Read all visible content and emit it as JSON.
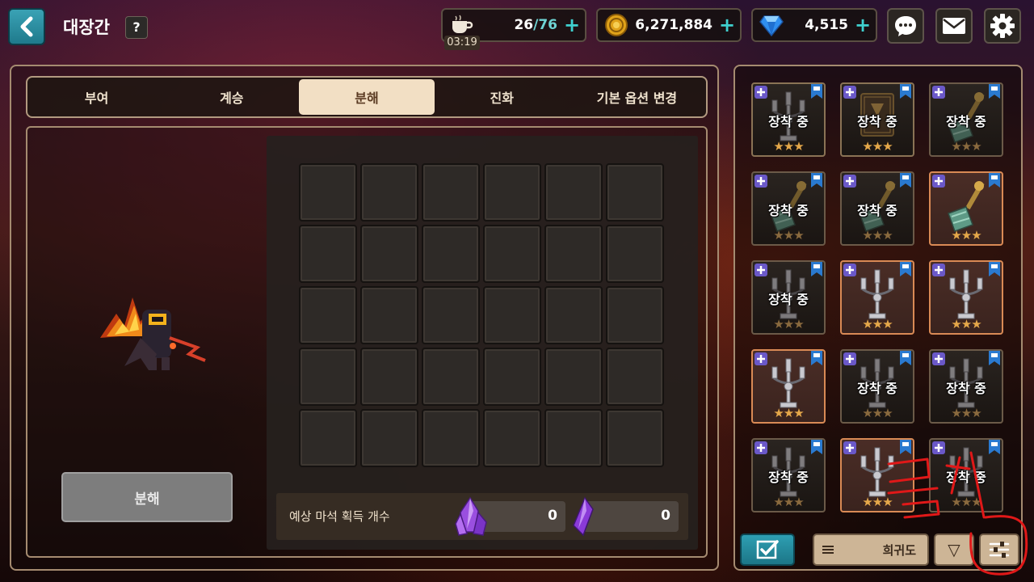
{
  "header": {
    "title": "대장간",
    "help_label": "?",
    "stamina": {
      "current": "26",
      "separator": "/",
      "max": "76",
      "timer": "03:19",
      "icon": "coffee-cup-icon"
    },
    "gold": {
      "value": "6,271,884",
      "icon": "gold-coin-icon"
    },
    "gems": {
      "value": "4,515",
      "icon": "diamond-icon"
    },
    "plus_label": "+"
  },
  "tabs": [
    {
      "label": "부여",
      "active": false
    },
    {
      "label": "계승",
      "active": false
    },
    {
      "label": "분해",
      "active": true
    },
    {
      "label": "진화",
      "active": false
    },
    {
      "label": "기본 옵션 변경",
      "active": false
    }
  ],
  "decompose": {
    "button_label": "분해",
    "expected_label": "예상 마석 획득 개수",
    "stone_a_count": "0",
    "stone_b_count": "0",
    "slot_rows": 5,
    "slot_cols": 6
  },
  "inventory": {
    "equipped_label": "장착 중",
    "items": [
      {
        "art": "candelabra",
        "equipped": true,
        "stars": "★★★",
        "style": "tan"
      },
      {
        "art": "book",
        "equipped": true,
        "stars": "★★★",
        "style": "tan"
      },
      {
        "art": "mace",
        "equipped": true,
        "stars": "★★★",
        "style": "dim"
      },
      {
        "art": "mace",
        "equipped": true,
        "stars": "★★★",
        "style": "dim"
      },
      {
        "art": "mace",
        "equipped": true,
        "stars": "★★★",
        "style": "dim"
      },
      {
        "art": "mace",
        "equipped": false,
        "stars": "★★★",
        "style": "orange"
      },
      {
        "art": "candelabra",
        "equipped": true,
        "stars": "★★★",
        "style": "dim"
      },
      {
        "art": "candelabra",
        "equipped": false,
        "stars": "★★★",
        "style": "orange"
      },
      {
        "art": "candelabra",
        "equipped": false,
        "stars": "★★★",
        "style": "orange"
      },
      {
        "art": "candelabra",
        "equipped": false,
        "stars": "★★★",
        "style": "orange"
      },
      {
        "art": "candelabra",
        "equipped": true,
        "stars": "★★★",
        "style": "dim"
      },
      {
        "art": "candelabra",
        "equipped": true,
        "stars": "★★★",
        "style": "dim"
      },
      {
        "art": "candelabra",
        "equipped": true,
        "stars": "★★★",
        "style": "dim"
      },
      {
        "art": "candelabra",
        "equipped": false,
        "stars": "★★★",
        "style": "orange"
      },
      {
        "art": "candelabra",
        "equipped": true,
        "stars": "★★★",
        "style": "dim"
      }
    ],
    "sort_label": "희귀도",
    "order_symbol": "▽"
  },
  "colors": {
    "accent": "#2e9fb3",
    "plus": "#3fd0cf",
    "active_tab": "#f2dfc4",
    "star": "#e5a84a",
    "annotation": "#e01818"
  }
}
